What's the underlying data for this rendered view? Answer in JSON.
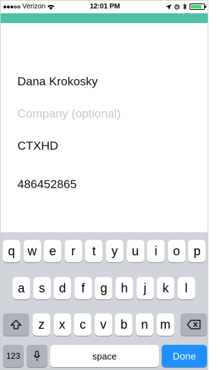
{
  "status_bar": {
    "carrier": "Verizon",
    "time": "12:01 PM",
    "battery_level": 0.85,
    "colors": {
      "battery_fill": "#4cd964"
    }
  },
  "header": {
    "color": "#4fbfa5"
  },
  "form": {
    "name_value": "Dana Krokosky",
    "company_placeholder": "Company (optional)",
    "code_value": "CTXHD",
    "phone_value": "486452865"
  },
  "keyboard": {
    "row1": [
      "q",
      "w",
      "e",
      "r",
      "t",
      "y",
      "u",
      "i",
      "o",
      "p"
    ],
    "row2": [
      "a",
      "s",
      "d",
      "f",
      "g",
      "h",
      "j",
      "k",
      "l"
    ],
    "row3": [
      "z",
      "x",
      "c",
      "v",
      "b",
      "n",
      "m"
    ],
    "numbers_label": "123",
    "space_label": "space",
    "done_label": "Done",
    "icons": {
      "shift": "shift-icon",
      "delete": "backspace-icon",
      "mic": "microphone-icon"
    },
    "colors": {
      "done": "#1e90ff",
      "background": "#d1d4da"
    }
  }
}
